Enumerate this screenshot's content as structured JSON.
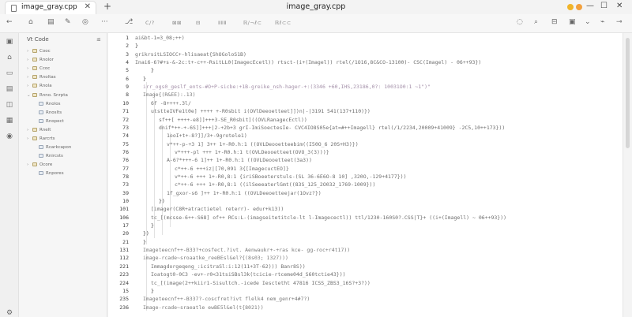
{
  "window": {
    "title": "image_gray.cpp",
    "controls": {
      "minimize": "—",
      "maximize": "☐",
      "close": "✕"
    },
    "traffic_colors": [
      "#f0b429",
      "#f2a03d",
      "#e87a6a"
    ]
  },
  "tab": {
    "label": "image_gray.cpp",
    "close": "✕",
    "new": "+"
  },
  "toolbar": {
    "left_icons": [
      "back-arrow-icon",
      "home-icon",
      "document-icon",
      "target-icon",
      "more-icon"
    ],
    "more_label": "···",
    "items": [
      "C/?",
      "⊠⊠",
      "⊟",
      "ⅡⅡⅡ",
      "ℝ/¬ℓ⊂",
      "ℝℓ⊂⊂"
    ],
    "right_icons": [
      "bulb-icon",
      "search-icon",
      "layout-icon",
      "chevron-icon",
      "wand-icon",
      "pin-icon"
    ]
  },
  "explorer": {
    "header": "Vt Code",
    "action": "≤",
    "items": [
      {
        "label": "Cooc",
        "chevron": "›",
        "folder": true
      },
      {
        "label": "Rnolor",
        "chevron": "›",
        "folder": true
      },
      {
        "label": "Ccoc",
        "chevron": "›",
        "folder": true
      },
      {
        "label": "Rnoltas",
        "chevron": "›",
        "folder": true
      },
      {
        "label": "Rnola",
        "chevron": "›",
        "folder": true
      },
      {
        "label": "Rnno. Snrpta",
        "chevron": "⌄",
        "folder": true
      },
      {
        "label": "Rnolos",
        "chevron": "",
        "folder": false
      },
      {
        "label": "Rnoslts",
        "chevron": "",
        "folder": false
      },
      {
        "label": "Rnopect",
        "chevron": "",
        "folder": false
      },
      {
        "label": "Rnelt",
        "chevron": "›",
        "folder": true
      },
      {
        "label": "Rarcrts",
        "chevron": "›",
        "folder": true
      },
      {
        "label": "Rcarkcapon",
        "chevron": "",
        "folder": false
      },
      {
        "label": "Rnircsts",
        "chevron": "",
        "folder": false
      },
      {
        "label": "Ocore",
        "chevron": "›",
        "folder": true
      },
      {
        "label": "Rnpores",
        "chevron": "",
        "folder": false
      }
    ]
  },
  "editor": {
    "lines": [
      {
        "num": "1",
        "indent": 0,
        "text": "ai&bt-1=3_08;++)"
      },
      {
        "num": "2",
        "indent": 0,
        "text": "}"
      },
      {
        "num": "3",
        "indent": 0,
        "text": "grikrsitLSIOCC+-hlisaeat{ShOGoloS1B)"
      },
      {
        "num": "4",
        "indent": 0,
        "text": "Inai6-6?#+s-&-2c:t+-c++-RsitLL0(ImagecEcetl)) rtsct-(i+(Imagel)) rtel(/1O16,8C&CO-13100)- CSC(Imagel) - 06++93})"
      },
      {
        "num": "5",
        "indent": 2,
        "text": "}"
      },
      {
        "num": "6",
        "indent": 1,
        "text": "}"
      },
      {
        "num": "9",
        "indent": 1,
        "text": "irr_ogs0_geslf_ents-#O+P-sicbe:+1B-greike_nsh-hager-+:(3346 +60,IHS,23186,0?: 10031O0:1 ~1\")\""
      },
      {
        "num": "8",
        "indent": 1,
        "text": "Image{(R&EE):.13)"
      },
      {
        "num": "10",
        "indent": 2,
        "text": "6f -8++++.3l/"
      },
      {
        "num": "71",
        "indent": 2,
        "text": "utstteIVFe1t0e] ++++ +-R0sbit i(OVlDeeoetteet]])n|-|3191 541(137+110)})"
      },
      {
        "num": "72",
        "indent": 3,
        "text": "sf++[ ++++-e8]]+++3-SE_R0sbit]((OVLRanagecEctl))"
      },
      {
        "num": "73",
        "indent": 3,
        "text": "dnif*++-+-6S]]+++|2-+2b+3 grI-ImiSoectesIe- CVC4IO8S05e{at=#++Imagell} rtel(/1/2234,20009+41009} -2C5,10++173}))"
      },
      {
        "num": "74",
        "indent": 4,
        "text": "1ooI+t+-8?]]/3+-9grotele1)"
      },
      {
        "num": "75",
        "indent": 4,
        "text": "v*++-p-+3 1] 3++ 1+-R0.h:1 ((OVLDeooetteebim((I50O_6 20S+H3)})"
      },
      {
        "num": "76",
        "indent": 5,
        "text": "v*+++-pl +++ 1+-R0.h:1 t(OVLDeooetteet(OVO_3(3)))}"
      },
      {
        "num": "76",
        "indent": 4,
        "text": "A-6?*+++-6 1]++ 1+-R0.h:1 ((OVLDeooetteet(3a3))"
      },
      {
        "num": "77",
        "indent": 5,
        "text": "c*++-6 +++iz|[70,091 3{[ImagecuctEO]}"
      },
      {
        "num": "78",
        "indent": 5,
        "text": "v*++-6 +++ 1+-R0,8:1 {iriSBoeeterstuls-(SL 36-6E6O-8 10] ,320O,-129+4177}))"
      },
      {
        "num": "73",
        "indent": 5,
        "text": "c*++-6 +++ 1+-R0,8:1 ((ilSeeeaterlGmt((83S_125_2O032_1769-1009}))"
      },
      {
        "num": "39",
        "indent": 4,
        "text": "1f_gxor-s6 ]++ 1+-R0.h:1 ((OVLDeeoetteejar(1Ovz?})"
      },
      {
        "num": "10",
        "indent": 3,
        "text": "})"
      },
      {
        "num": "101",
        "indent": 2,
        "text": "[imager(C8R+atractietel reterr)- edur+k13))"
      },
      {
        "num": "106",
        "indent": 2,
        "text": "tc_[(mcsse-6++-S68] of++ RCs:L-(imagseitetitcle-lt l-Imagecectl)) ttl/1230-160S0?.CSS|T}+ ((i+(Imagell) ~ 06++93}))"
      },
      {
        "num": "17",
        "indent": 2,
        "text": "}"
      },
      {
        "num": "20",
        "indent": 1,
        "text": "})"
      },
      {
        "num": "21",
        "indent": 1,
        "text": "}"
      },
      {
        "num": "131",
        "indent": 1,
        "text": "Imageteecnf++-B33?+cosfect.?ivt. Aenwaukr+-+ras kce- gg-roc+r4t17))"
      },
      {
        "num": "112",
        "indent": 1,
        "text": "image-rcade~sroaatke_reeBEsl&el?{(8s03; 1327)))"
      },
      {
        "num": "221",
        "indent": 2,
        "text": "Immagdorgeqeng_:icitraSl:i:12(11+3T·62))) Banr8S))"
      },
      {
        "num": "223",
        "indent": 2,
        "text": "Ioatogt0-0C3 -ev+-r0<31tsiSBsl3k(tcicie-rtceme04d_S60tctie43}))"
      },
      {
        "num": "224",
        "indent": 2,
        "text": "tc_[(image(2++kiir1-Sisultch.-icede Iesctetht 47816 ICSS_ZBS3_16S?+3?))"
      },
      {
        "num": "15",
        "indent": 2,
        "text": "}"
      },
      {
        "num": "235",
        "indent": 1,
        "text": "Imageteecnf++-B337?-coscfret?ivt flelk4 nem_genr+4#7?)"
      },
      {
        "num": "236",
        "indent": 1,
        "text": "Image-rcade~sraeatle ewBE5l&el(t{8021))"
      }
    ]
  }
}
